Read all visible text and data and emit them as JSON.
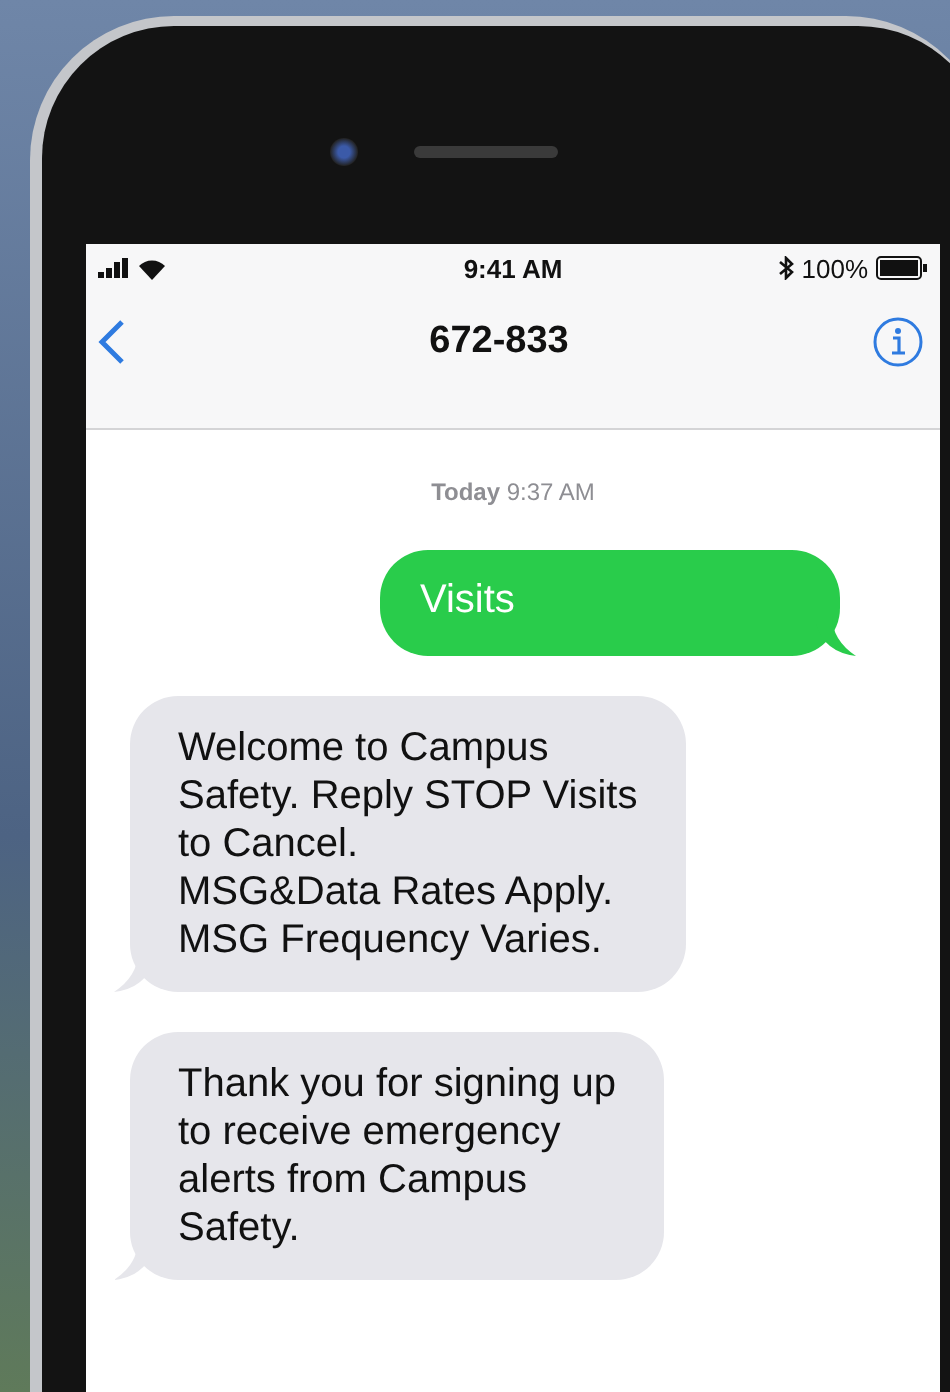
{
  "status_bar": {
    "time": "9:41 AM",
    "battery": "100%"
  },
  "header": {
    "title": "672-833"
  },
  "timestamp": "**Today** 9:37 AM",
  "messages": [
    {
      "kind": "outgoing",
      "text": "Visits"
    },
    {
      "kind": "incoming",
      "text": "Welcome to Campus\nSafety. Reply STOP Visits\nto Cancel.\nMSG&Data Rates Apply.\nMSG Frequency Varies."
    },
    {
      "kind": "incoming",
      "text": "Thank you for signing up\nto receive emergency\nalerts from Campus\nSafety."
    }
  ]
}
